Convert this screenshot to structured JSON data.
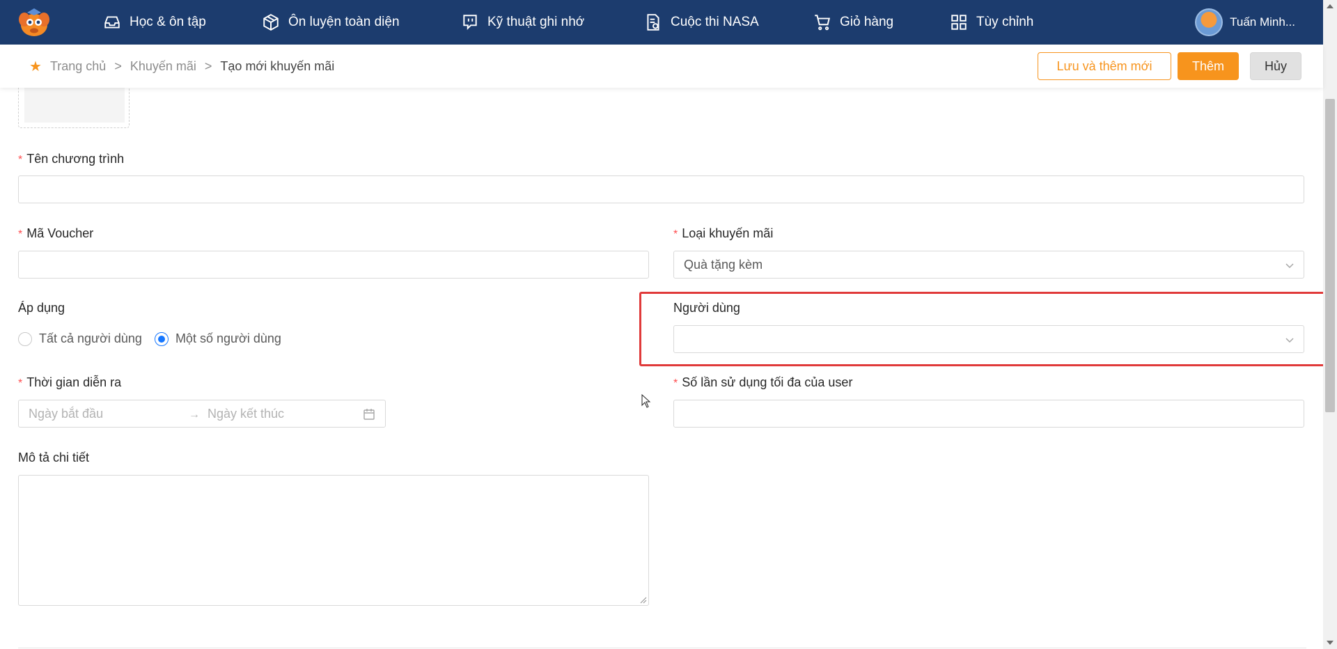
{
  "nav": {
    "items": [
      {
        "label": "Học & ôn tập",
        "icon": "inbox-icon"
      },
      {
        "label": "Ôn luyện toàn diện",
        "icon": "cube-icon"
      },
      {
        "label": "Kỹ thuật ghi nhớ",
        "icon": "chat-bubble-icon"
      },
      {
        "label": "Cuộc thi NASA",
        "icon": "document-check-icon"
      },
      {
        "label": "Giỏ hàng",
        "icon": "cart-icon"
      },
      {
        "label": "Tùy chỉnh",
        "icon": "grid-icon"
      }
    ],
    "user_name": "Tuấn Minh..."
  },
  "breadcrumb": {
    "home": "Trang chủ",
    "section": "Khuyến mãi",
    "current": "Tạo mới khuyến mãi",
    "separator": ">"
  },
  "actions": {
    "save_and_new": "Lưu và thêm mới",
    "add": "Thêm",
    "cancel": "Hủy"
  },
  "form": {
    "program_name_label": "Tên chương trình",
    "program_name_value": "",
    "voucher_code_label": "Mã Voucher",
    "voucher_code_value": "",
    "promo_type_label": "Loại khuyến mãi",
    "promo_type_value": "Quà tặng kèm",
    "apply_label": "Áp dụng",
    "apply_options": [
      "Tất cả người dùng",
      "Một số người dùng"
    ],
    "apply_selected": "Một số người dùng",
    "users_label": "Người dùng",
    "users_value": "",
    "duration_label": "Thời gian diễn ra",
    "start_placeholder": "Ngày bắt đầu",
    "end_placeholder": "Ngày kết thúc",
    "max_usage_label": "Số lần sử dụng tối đa của user",
    "max_usage_value": "",
    "description_label": "Mô tả chi tiết",
    "description_value": ""
  },
  "colors": {
    "nav_bg": "#1c3c6e",
    "accent": "#f7941d",
    "required": "#ff4d4f",
    "radio_selected": "#1677ff",
    "highlight": "#e03a3a"
  }
}
